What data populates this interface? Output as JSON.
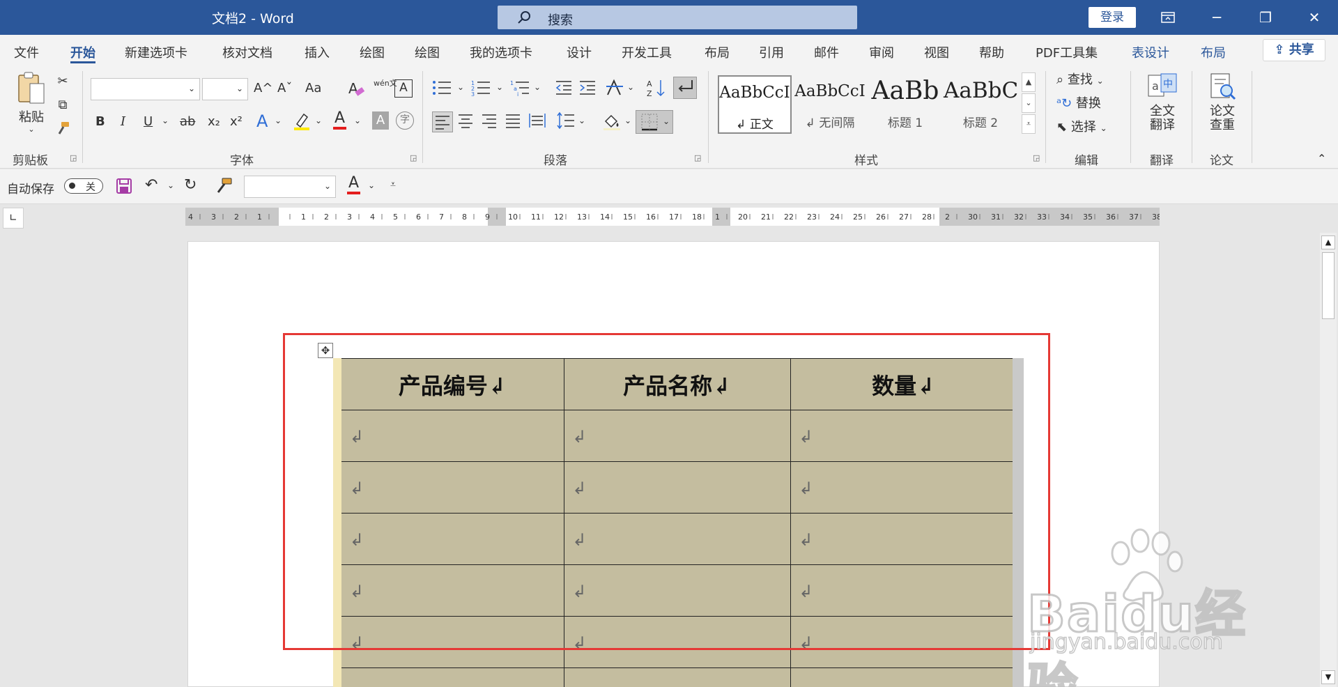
{
  "titlebar": {
    "doc_title": "文档2  -  Word",
    "search_placeholder": "搜索",
    "login": "登录"
  },
  "menu": {
    "tabs": [
      "文件",
      "开始",
      "新建选项卡",
      "核对文档",
      "插入",
      "绘图",
      "绘图",
      "我的选项卡",
      "设计",
      "开发工具",
      "布局",
      "引用",
      "邮件",
      "审阅",
      "视图",
      "帮助",
      "PDF工具集",
      "表设计",
      "布局"
    ],
    "active_tab": "开始",
    "share": "共享"
  },
  "ribbon": {
    "clipboard": {
      "label": "剪贴板",
      "paste": "粘贴"
    },
    "font": {
      "label": "字体",
      "bold": "B",
      "italic": "I",
      "underline": "U",
      "strike": "ab",
      "sub": "x₂",
      "sup": "x²",
      "grow": "A^",
      "shrink": "Aˇ",
      "case": "Aa",
      "phonetic": "wén文",
      "border_char": "A",
      "char_shade": "A",
      "enclose": "字"
    },
    "paragraph": {
      "label": "段落"
    },
    "styles": {
      "label": "样式",
      "items": [
        {
          "sample": "AaBbCcI",
          "name": "↲ 正文"
        },
        {
          "sample": "AaBbCcI",
          "name": "↲ 无间隔"
        },
        {
          "sample": "AaBb",
          "name": "标题 1"
        },
        {
          "sample": "AaBbC",
          "name": "标题 2"
        }
      ]
    },
    "editing": {
      "label": "编辑",
      "find": "查找",
      "replace": "替换",
      "select": "选择"
    },
    "translate": {
      "label": "翻译",
      "full": "全文翻译"
    },
    "thesis": {
      "label": "论文",
      "check": "论文查重"
    }
  },
  "qat": {
    "autosave": "自动保存",
    "toggle_state": "关"
  },
  "ruler": {
    "left_numbers": [
      "4",
      "3",
      "2",
      "1"
    ],
    "numbers": [
      "1",
      "2",
      "3",
      "4",
      "5",
      "6",
      "7",
      "8",
      "9",
      "10",
      "11",
      "12",
      "13",
      "14",
      "15",
      "16",
      "17",
      "18",
      "1",
      "20",
      "21",
      "22",
      "23",
      "24",
      "25",
      "26",
      "27",
      "28",
      "2",
      "30",
      "31",
      "32",
      "33",
      "34",
      "35",
      "36",
      "37",
      "38"
    ]
  },
  "table": {
    "headers": [
      "产品编号↲",
      "产品名称↲",
      "数量↲"
    ],
    "empty_rows": 6,
    "cell_mark": "↲"
  },
  "watermark": {
    "logo": "Baidu经验",
    "url": "jingyan.baidu.com"
  },
  "colors": {
    "title_bar": "#2b579a",
    "table_fill": "#c4bd9f",
    "highlight_frame": "#e53935"
  }
}
